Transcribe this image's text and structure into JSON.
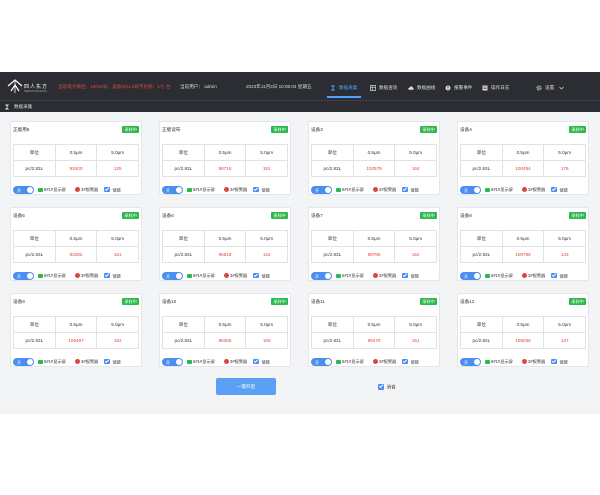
{
  "header": {
    "logo_text": "四人东方",
    "logo_sub": "SIREN DONGFANG",
    "alert_text": "当前电子质控：10043号，设备4(01.0段不达标：17)",
    "alert_count": "台",
    "user_label": "当前用户：",
    "user_name": "admin",
    "datetime": "2023年11月3日 10:08:04 星期五"
  },
  "nav": [
    {
      "label": "数据采集",
      "icon": "hourglass-icon",
      "active": true
    },
    {
      "label": "数据查询",
      "icon": "table-icon",
      "active": false
    },
    {
      "label": "数据曲线",
      "icon": "cloud-icon",
      "active": false
    },
    {
      "label": "报警事件",
      "icon": "alarm-icon",
      "active": false
    },
    {
      "label": "操作日志",
      "icon": "log-icon",
      "active": false
    },
    {
      "label": "设置",
      "icon": "gear-icon",
      "active": false
    }
  ],
  "breadcrumb": "数据采集",
  "table_headers": {
    "unit": "单位",
    "c1": "0.5μm",
    "c2": "5.0μm"
  },
  "unit": "pc/2.83L",
  "toggle_label": "开",
  "display_label": "6#1#显示屏",
  "alarm_label": "3#报警器",
  "enable_label": "使能",
  "status_color": "#2db84d",
  "devices": [
    {
      "name": "正版用8",
      "status": "采样中",
      "v1": "93400",
      "v2": "125"
    },
    {
      "name": "正版读布",
      "status": "采样中",
      "v1": "88716",
      "v2": "151"
    },
    {
      "name": "设备3",
      "status": "采样中",
      "v1": "102579",
      "v2": "164"
    },
    {
      "name": "设备4",
      "status": "采样中",
      "v1": "100484",
      "v2": "176"
    },
    {
      "name": "设备5",
      "status": "采样中",
      "v1": "93262",
      "v2": "151"
    },
    {
      "name": "设备6",
      "status": "采样中",
      "v1": "95818",
      "v2": "124"
    },
    {
      "name": "设备7",
      "status": "采样中",
      "v1": "98785",
      "v2": "152"
    },
    {
      "name": "设备8",
      "status": "采样中",
      "v1": "100796",
      "v2": "143"
    },
    {
      "name": "设备9",
      "status": "采样中",
      "v1": "105497",
      "v2": "182"
    },
    {
      "name": "设备10",
      "status": "采样中",
      "v1": "96365",
      "v2": "166"
    },
    {
      "name": "设备11",
      "status": "采样中",
      "v1": "99470",
      "v2": "151"
    },
    {
      "name": "设备12",
      "status": "采样中",
      "v1": "106036",
      "v2": "137"
    }
  ],
  "start_all": "一键开启",
  "mute_label": "消音"
}
